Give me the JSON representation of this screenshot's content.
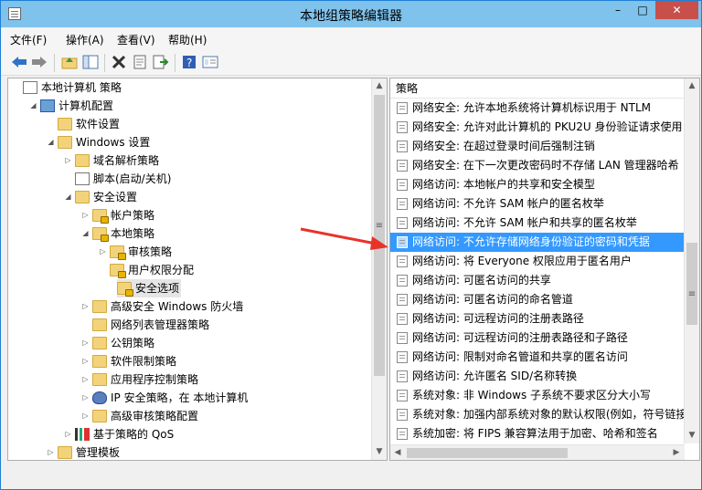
{
  "window": {
    "title": "本地组策略编辑器",
    "minimize": "–",
    "maximize": "□",
    "close": "✕"
  },
  "menu": [
    "文件(F)",
    "操作(A)",
    "查看(V)",
    "帮助(H)"
  ],
  "toolbar": [
    "back-icon",
    "forward-icon",
    "up-folder-icon",
    "show-tree-icon",
    "delete-icon",
    "properties-icon",
    "export-icon",
    "help-icon",
    "view-icon"
  ],
  "tree": [
    {
      "label": "本地计算机 策略",
      "level": 0,
      "expander": "",
      "icon": "doc"
    },
    {
      "label": "计算机配置",
      "level": 1,
      "expander": "◢",
      "icon": "pc"
    },
    {
      "label": "软件设置",
      "level": 2,
      "expander": "",
      "icon": "folder"
    },
    {
      "label": "Windows 设置",
      "level": 2,
      "expander": "◢",
      "icon": "folder"
    },
    {
      "label": "域名解析策略",
      "level": 3,
      "expander": "▷",
      "icon": "folder"
    },
    {
      "label": "脚本(启动/关机)",
      "level": 3,
      "expander": "",
      "icon": "doc"
    },
    {
      "label": "安全设置",
      "level": 3,
      "expander": "◢",
      "icon": "folder"
    },
    {
      "label": "帐户策略",
      "level": 4,
      "expander": "▷",
      "icon": "folder lock"
    },
    {
      "label": "本地策略",
      "level": 4,
      "expander": "◢",
      "icon": "folder lock"
    },
    {
      "label": "审核策略",
      "level": 5,
      "expander": "▷",
      "icon": "folder lock"
    },
    {
      "label": "用户权限分配",
      "level": 5,
      "expander": "",
      "icon": "folder lock"
    },
    {
      "label": "安全选项",
      "level": 5,
      "expander": "",
      "icon": "folder lock",
      "selected": true
    },
    {
      "label": "高级安全 Windows 防火墙",
      "level": 4,
      "expander": "▷",
      "icon": "folder"
    },
    {
      "label": "网络列表管理器策略",
      "level": 4,
      "expander": "",
      "icon": "folder"
    },
    {
      "label": "公钥策略",
      "level": 4,
      "expander": "▷",
      "icon": "folder"
    },
    {
      "label": "软件限制策略",
      "level": 4,
      "expander": "▷",
      "icon": "folder"
    },
    {
      "label": "应用程序控制策略",
      "level": 4,
      "expander": "▷",
      "icon": "folder"
    },
    {
      "label": "IP 安全策略，在 本地计算机",
      "level": 4,
      "expander": "▷",
      "icon": "shield"
    },
    {
      "label": "高级审核策略配置",
      "level": 4,
      "expander": "▷",
      "icon": "folder"
    },
    {
      "label": "基于策略的 QoS",
      "level": 3,
      "expander": "▷",
      "icon": "chart"
    },
    {
      "label": "管理模板",
      "level": 2,
      "expander": "▷",
      "icon": "folder"
    }
  ],
  "policy_header": "策略",
  "policies": [
    {
      "label": "网络安全: 允许本地系统将计算机标识用于 NTLM"
    },
    {
      "label": "网络安全: 允许对此计算机的 PKU2U 身份验证请求使用"
    },
    {
      "label": "网络安全: 在超过登录时间后强制注销"
    },
    {
      "label": "网络安全: 在下一次更改密码时不存储 LAN 管理器哈希"
    },
    {
      "label": "网络访问: 本地帐户的共享和安全模型"
    },
    {
      "label": "网络访问: 不允许 SAM 帐户的匿名枚举"
    },
    {
      "label": "网络访问: 不允许 SAM 帐户和共享的匿名枚举"
    },
    {
      "label": "网络访问: 不允许存储网络身份验证的密码和凭据",
      "selected": true
    },
    {
      "label": "网络访问: 将 Everyone 权限应用于匿名用户"
    },
    {
      "label": "网络访问: 可匿名访问的共享"
    },
    {
      "label": "网络访问: 可匿名访问的命名管道"
    },
    {
      "label": "网络访问: 可远程访问的注册表路径"
    },
    {
      "label": "网络访问: 可远程访问的注册表路径和子路径"
    },
    {
      "label": "网络访问: 限制对命名管道和共享的匿名访问"
    },
    {
      "label": "网络访问: 允许匿名 SID/名称转换"
    },
    {
      "label": "系统对象: 非 Windows 子系统不要求区分大小写"
    },
    {
      "label": "系统对象: 加强内部系统对象的默认权限(例如，符号链接"
    },
    {
      "label": "系统加密: 将 FIPS 兼容算法用于加密、哈希和签名"
    }
  ],
  "colors": {
    "selection": "#3399ff",
    "arrow": "#e8322a",
    "titlebar": "#7fc2ec",
    "close": "#c7504b"
  }
}
